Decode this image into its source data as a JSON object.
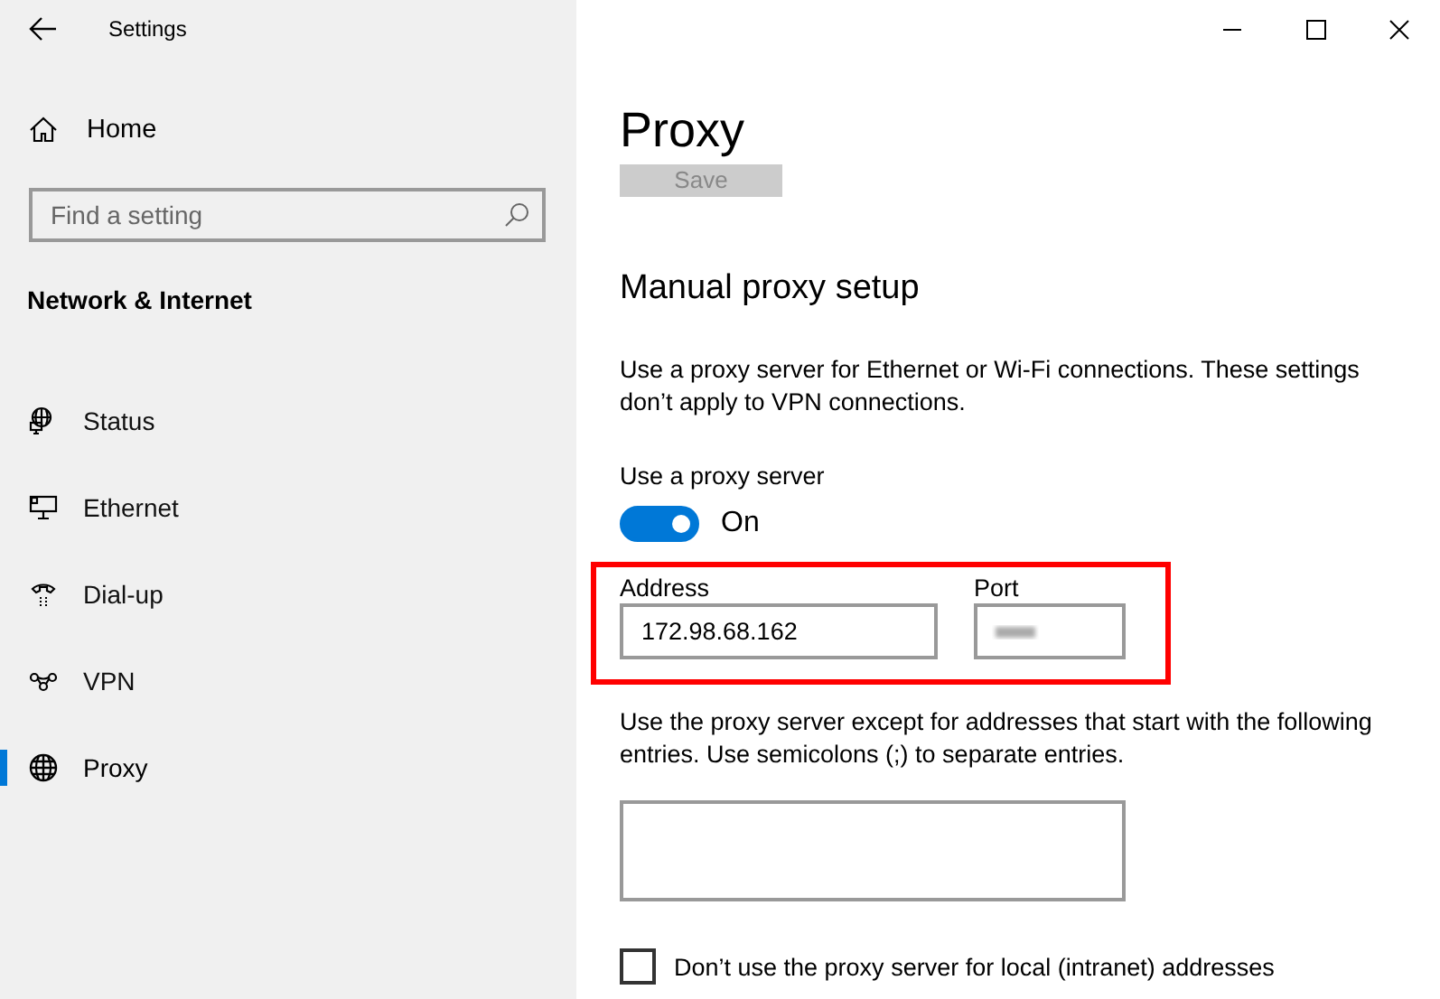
{
  "window": {
    "title": "Settings",
    "controls": [
      {
        "kind": "minimize"
      },
      {
        "kind": "maximize"
      },
      {
        "kind": "close"
      }
    ]
  },
  "sidebar": {
    "home": "Home",
    "search": {
      "placeholder": "Find a setting"
    },
    "section": "Network & Internet",
    "items": [
      {
        "label": "Status",
        "selected": false
      },
      {
        "label": "Ethernet",
        "selected": false
      },
      {
        "label": "Dial-up",
        "selected": false
      },
      {
        "label": "VPN",
        "selected": false
      },
      {
        "label": "Proxy",
        "selected": true
      }
    ]
  },
  "page": {
    "title": "Proxy",
    "save_button": {
      "label": "Save",
      "disabled": true
    },
    "section": "Manual proxy setup",
    "description": "Use a proxy server for Ethernet or Wi-Fi connections. These settings don’t apply to VPN connections.",
    "use_proxy": {
      "label": "Use a proxy server",
      "on": true,
      "state_label": "On"
    },
    "proxy_fields": {
      "highlighted": true,
      "address": {
        "label": "Address",
        "value": "172.98.68.162"
      },
      "port": {
        "label": "Port",
        "blurred": true
      }
    },
    "exceptions": {
      "description": "Use the proxy server except for addresses that start with the following entries. Use semicolons (;) to separate entries."
    },
    "local_bypass": {
      "label": "Don’t use the proxy server for local (intranet) addresses",
      "checked": false
    }
  }
}
